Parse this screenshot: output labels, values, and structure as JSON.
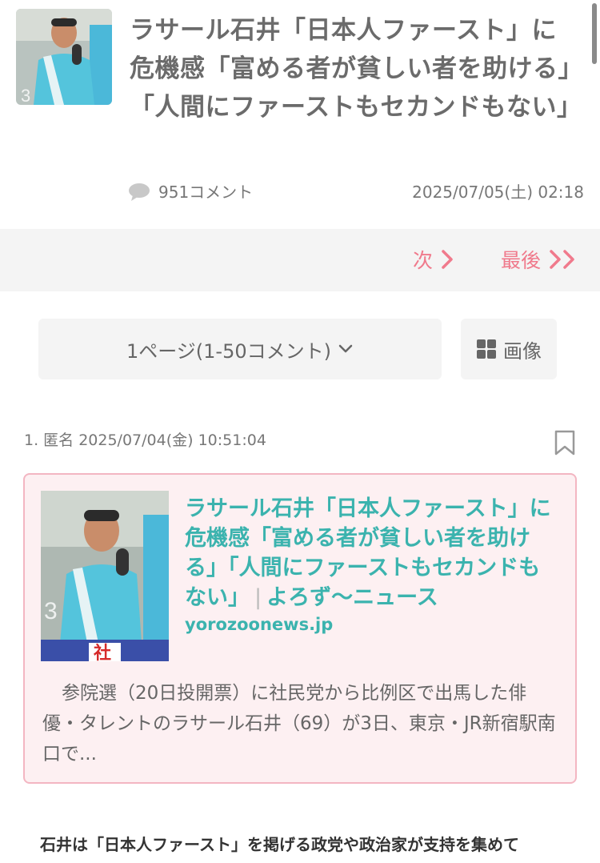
{
  "article": {
    "title": "ラサール石井「日本人ファースト」に危機感「富める者が貧しい者を助ける」「人間にファーストもセカンドもない」",
    "thumbnail_icon": "news-photo-speaker",
    "comment_count": "951コメント",
    "timestamp": "2025/07/05(土) 02:18"
  },
  "pager": {
    "next_label": "次",
    "last_label": "最後",
    "accent_color": "#f07a8c"
  },
  "controls": {
    "page_select_value": "1ページ(1-50コメント)",
    "image_button_label": "画像"
  },
  "post": {
    "header": "1. 匿名 2025/07/04(金) 10:51:04",
    "link_card": {
      "title": "ラサール石井「日本人ファースト」に危機感「富める者が貧しい者を助ける」「人間にファーストもセカンドもない」",
      "separator": "|",
      "site_name": "よろず〜ニュース",
      "domain": "yorozoonews.jp",
      "description": "参院選（20日投開票）に社民党から比例区で出馬した俳優・タレントのラサール石井（69）が3日、東京・JR新宿駅南口で...",
      "accent_color": "#3bb3ae"
    },
    "body": "石井は「日本人ファースト」を掲げる政党や政治家が支持を集めて"
  }
}
